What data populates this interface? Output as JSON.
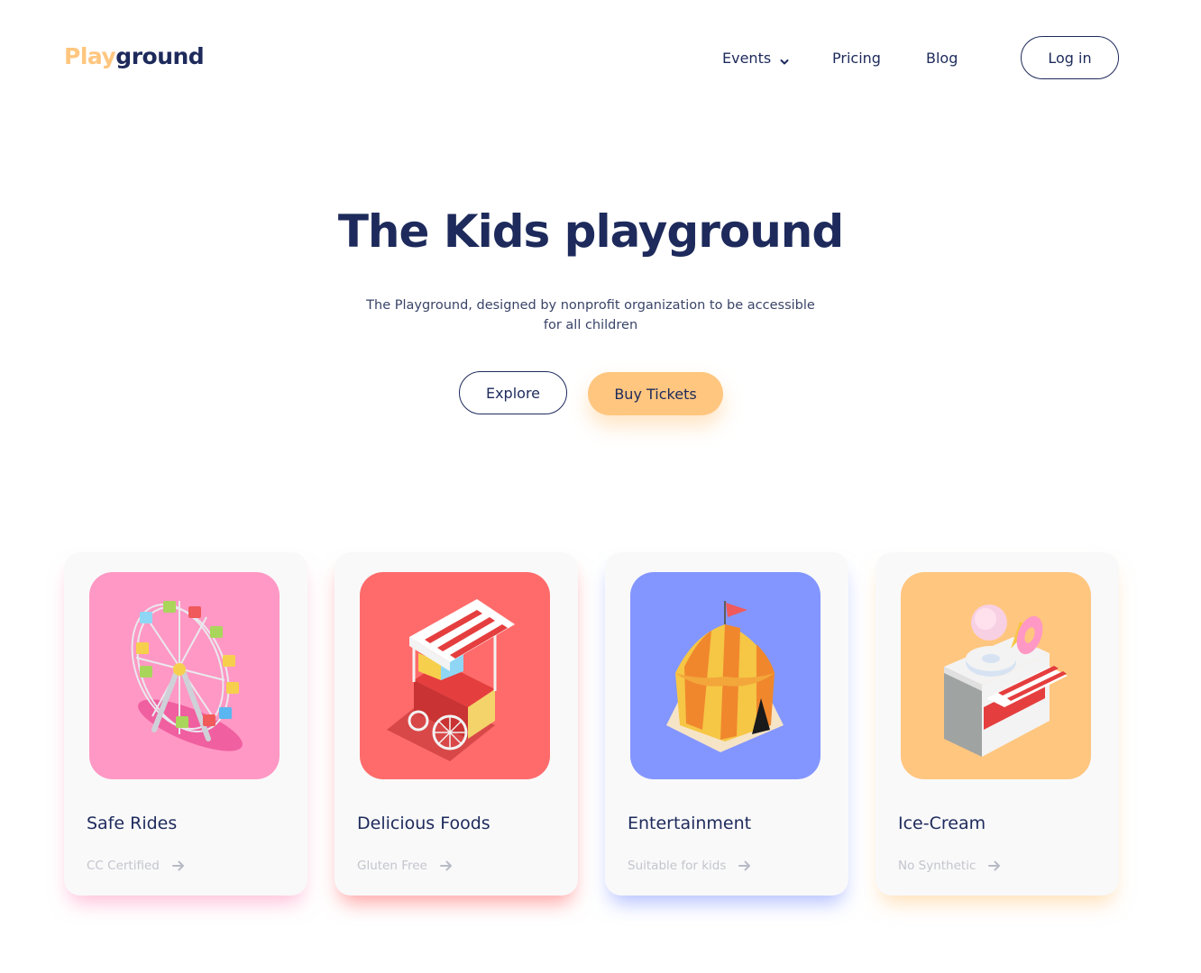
{
  "brand": {
    "part1": "Play",
    "part2": "ground"
  },
  "nav": {
    "items": [
      {
        "label": "Events",
        "icon": "chevron-down-icon"
      },
      {
        "label": "Pricing"
      },
      {
        "label": "Blog"
      }
    ],
    "login_label": "Log in"
  },
  "hero": {
    "title": "The Kids playground",
    "subtitle": "The Playground, designed by nonprofit organization to be accessible for all children",
    "explore_label": "Explore",
    "buy_label": "Buy Tickets"
  },
  "colors": {
    "accent": "#ffc67f",
    "navy": "#1d2a5b",
    "card_pink": "#ff98c4",
    "card_red": "#ff6b6b",
    "card_blue": "#8396ff",
    "card_orange": "#ffc67f"
  },
  "cards": [
    {
      "title": "Safe Rides",
      "subtitle": "CC Certified",
      "image": "ferris-wheel-icon"
    },
    {
      "title": "Delicious Foods",
      "subtitle": "Gluten Free",
      "image": "food-cart-icon"
    },
    {
      "title": "Entertainment",
      "subtitle": "Suitable for kids",
      "image": "circus-tent-icon"
    },
    {
      "title": "Ice-Cream",
      "subtitle": "No Synthetic",
      "image": "ice-cream-stand-icon"
    }
  ]
}
